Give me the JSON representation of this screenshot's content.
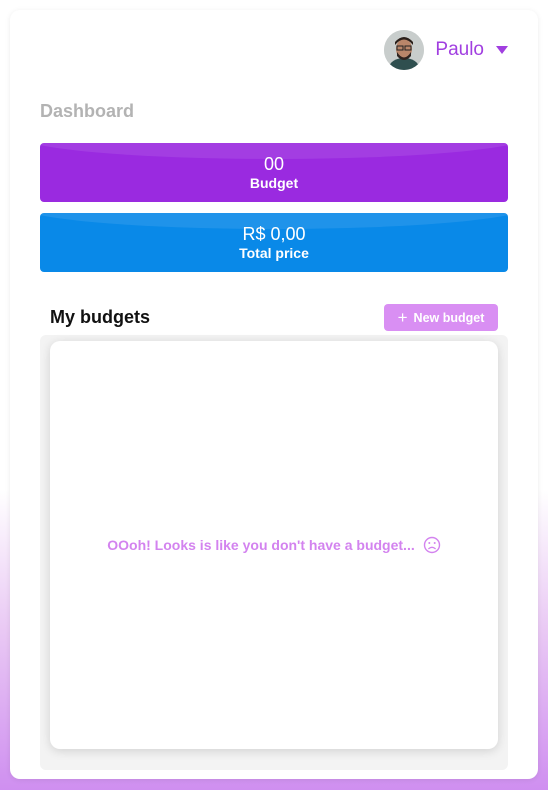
{
  "user": {
    "name": "Paulo"
  },
  "page": {
    "title": "Dashboard"
  },
  "stats": {
    "budget": {
      "value": "00",
      "label": "Budget"
    },
    "total_price": {
      "value": "R$ 0,00",
      "label": "Total price"
    }
  },
  "budgets": {
    "section_title": "My budgets",
    "new_button_label": "New budget",
    "empty_message": "OOoh! Looks is like you don't have a budget..."
  },
  "colors": {
    "accent_purple": "#9a2ae0",
    "accent_blue": "#0989e8",
    "soft_purple": "#d98ff3"
  },
  "icons": [
    "user-avatar",
    "chevron-down-icon",
    "plus-icon",
    "sad-face-icon"
  ]
}
